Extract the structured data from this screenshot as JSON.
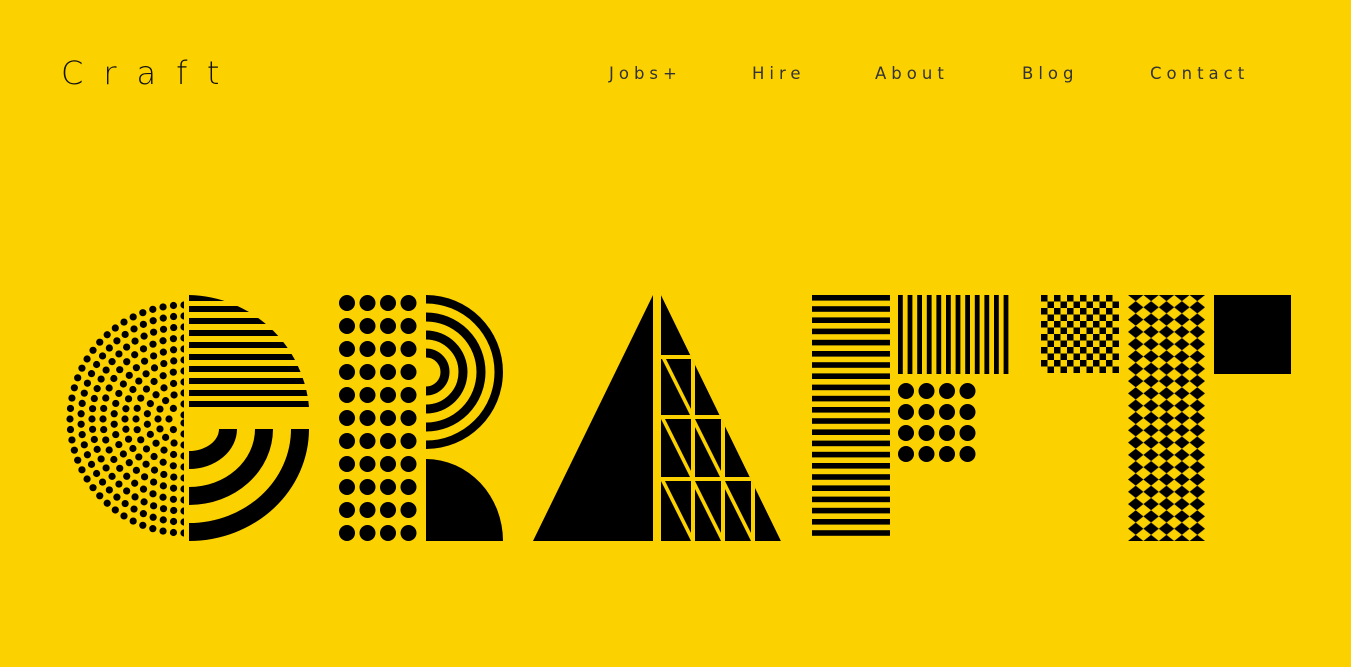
{
  "header": {
    "brand": "Craft",
    "nav": [
      {
        "label": "Jobs+"
      },
      {
        "label": "Hire"
      },
      {
        "label": "About"
      },
      {
        "label": "Blog"
      },
      {
        "label": "Contact"
      }
    ]
  },
  "hero": {
    "logo_text": "CRAFT"
  },
  "colors": {
    "background": "#fcd100",
    "ink": "#000000"
  }
}
